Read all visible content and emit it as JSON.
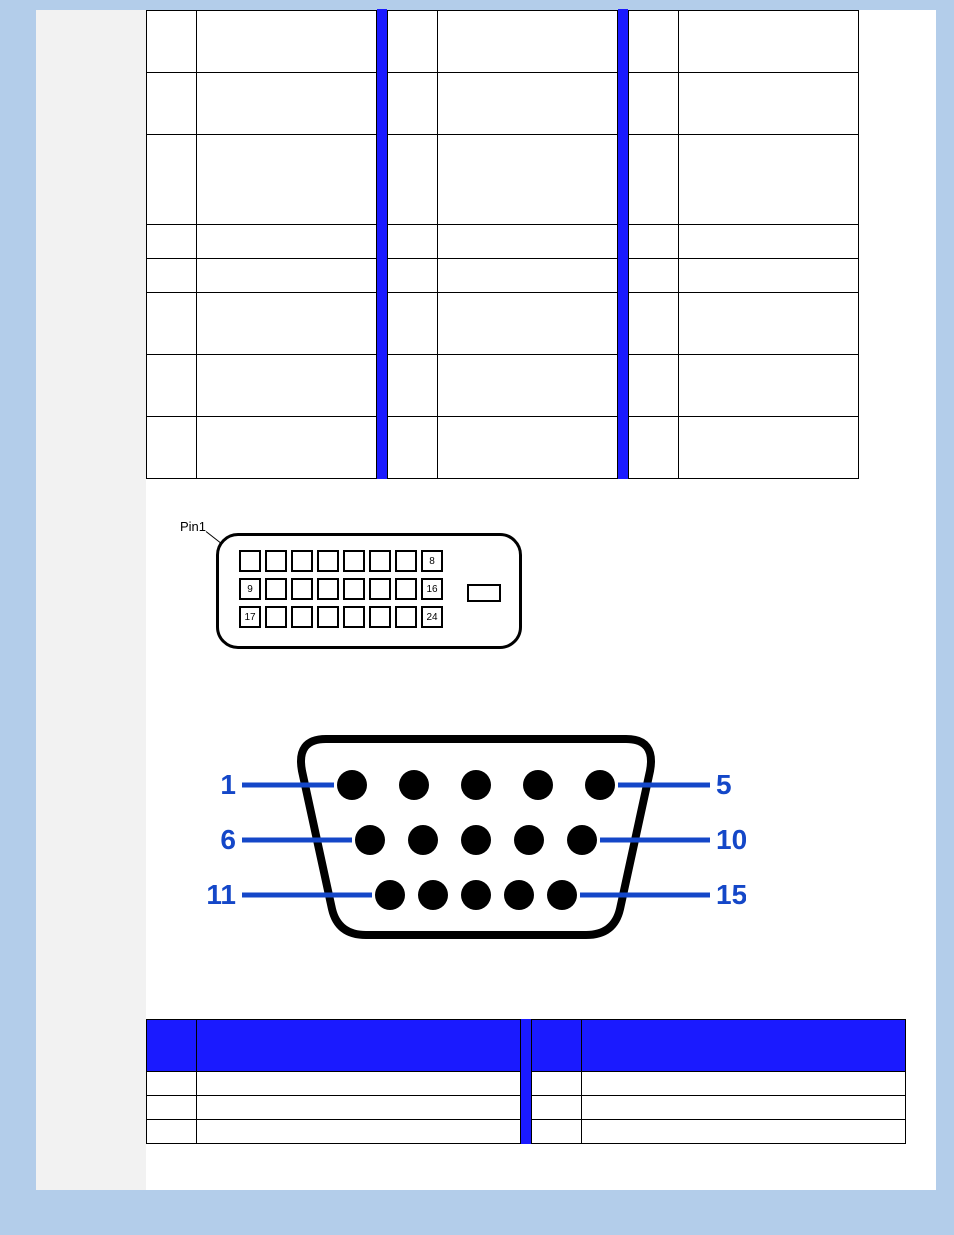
{
  "dvi_table": {
    "columns": [
      {
        "rows": [
          {
            "pin": "",
            "assignment": "",
            "h": "row-h-m"
          },
          {
            "pin": "",
            "assignment": "",
            "h": "row-h-m"
          },
          {
            "pin": "",
            "assignment": "",
            "h": "row-h-l"
          },
          {
            "pin": "",
            "assignment": "",
            "h": "row-h-s"
          },
          {
            "pin": "",
            "assignment": "",
            "h": "row-h-s"
          },
          {
            "pin": "",
            "assignment": "",
            "h": "row-h-m"
          },
          {
            "pin": "",
            "assignment": "",
            "h": "row-h-m"
          },
          {
            "pin": "",
            "assignment": "",
            "h": "row-h-m"
          }
        ]
      },
      {
        "rows": [
          {
            "pin": "",
            "assignment": "",
            "h": "row-h-m"
          },
          {
            "pin": "",
            "assignment": "",
            "h": "row-h-m"
          },
          {
            "pin": "",
            "assignment": "",
            "h": "row-h-l"
          },
          {
            "pin": "",
            "assignment": "",
            "h": "row-h-s"
          },
          {
            "pin": "",
            "assignment": "",
            "h": "row-h-s"
          },
          {
            "pin": "",
            "assignment": "",
            "h": "row-h-m"
          },
          {
            "pin": "",
            "assignment": "",
            "h": "row-h-m"
          },
          {
            "pin": "",
            "assignment": "",
            "h": "row-h-m"
          }
        ]
      },
      {
        "rows": [
          {
            "pin": "",
            "assignment": "",
            "h": "row-h-m"
          },
          {
            "pin": "",
            "assignment": "",
            "h": "row-h-m"
          },
          {
            "pin": "",
            "assignment": "",
            "h": "row-h-l"
          },
          {
            "pin": "",
            "assignment": "",
            "h": "row-h-s"
          },
          {
            "pin": "",
            "assignment": "",
            "h": "row-h-s"
          },
          {
            "pin": "",
            "assignment": "",
            "h": "row-h-m"
          },
          {
            "pin": "",
            "assignment": "",
            "h": "row-h-m"
          },
          {
            "pin": "",
            "assignment": "",
            "h": "row-h-m"
          }
        ]
      }
    ]
  },
  "dvi_diagram": {
    "pin1_label": "Pin1",
    "row_labels": {
      "row1_end": "8",
      "row2_start": "9",
      "row2_end": "16",
      "row3_start": "17",
      "row3_end": "24"
    }
  },
  "vga_diagram": {
    "left_labels": [
      "1",
      "6",
      "11"
    ],
    "right_labels": [
      "5",
      "10",
      "15"
    ]
  },
  "vga_table": {
    "header": {
      "pin": "",
      "desc": ""
    },
    "left": [
      {
        "pin": "",
        "desc": ""
      },
      {
        "pin": "",
        "desc": ""
      },
      {
        "pin": "",
        "desc": ""
      }
    ],
    "right": [
      {
        "pin": "",
        "desc": ""
      },
      {
        "pin": "",
        "desc": ""
      },
      {
        "pin": "",
        "desc": ""
      }
    ]
  }
}
